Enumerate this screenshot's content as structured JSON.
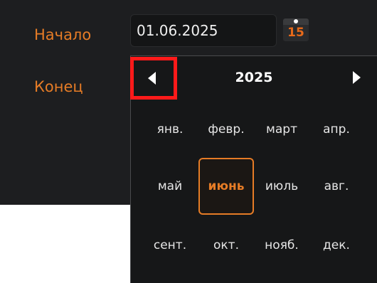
{
  "form": {
    "start_label": "Начало",
    "end_label": "Конец",
    "start_value": "01.06.2025",
    "calendar_icon": {
      "name": "calendar-icon",
      "day_number": "15"
    }
  },
  "picker": {
    "year": "2025",
    "prev_icon": "left-arrow-icon",
    "next_icon": "right-arrow-icon",
    "accent_color": "#e67c26",
    "highlight_color": "#ff1a1a",
    "selected_month": "июнь",
    "months": [
      "янв.",
      "февр.",
      "март",
      "апр.",
      "май",
      "июнь",
      "июль",
      "авг.",
      "сент.",
      "окт.",
      "нояб.",
      "дек."
    ]
  }
}
